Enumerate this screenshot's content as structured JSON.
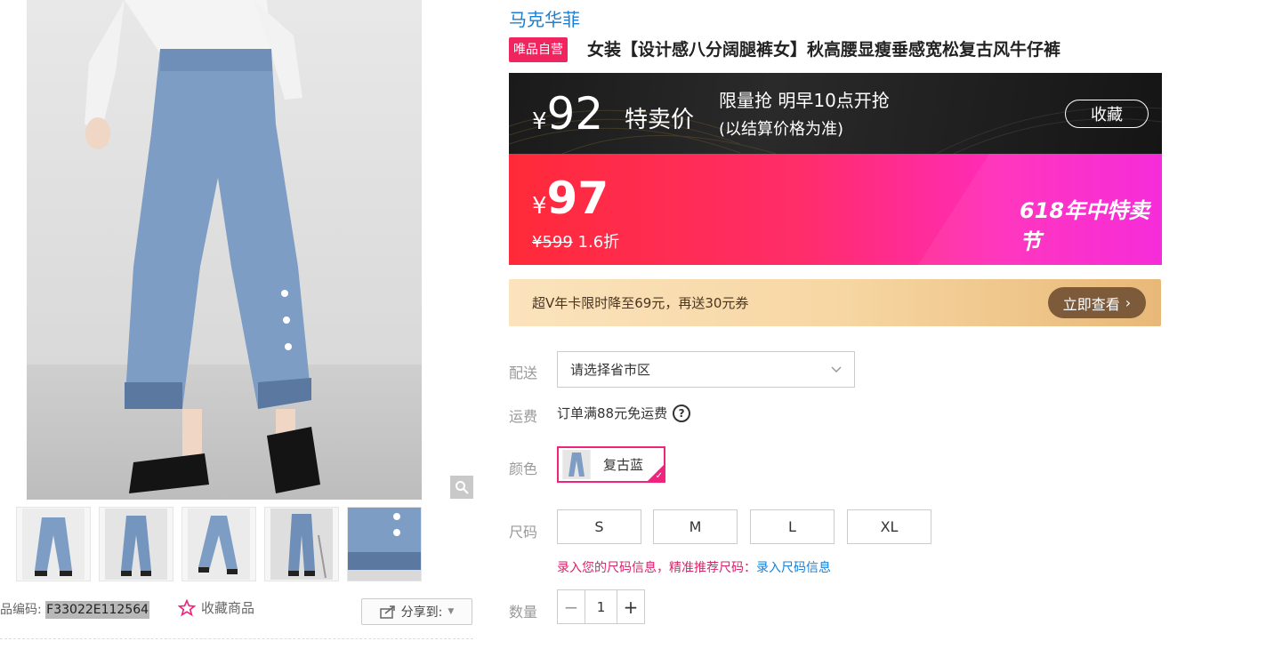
{
  "gallery": {
    "zoom_icon": "magnifier-icon",
    "thumbnails": [
      "jeans-front",
      "jeans-side",
      "jeans-model-walk",
      "jeans-chair",
      "jeans-hem-detail"
    ],
    "item_code_label": "品编码:",
    "item_code": "F33022E112564",
    "favorite_label": "收藏商品",
    "share_label": "分享到:"
  },
  "product": {
    "brand": "马克华菲",
    "tag": "唯品自营",
    "title": "女装【设计感八分阔腿裤女】秋高腰显瘦垂感宽松复古风牛仔裤"
  },
  "special_price": {
    "currency": "¥",
    "price": "92",
    "label": "特卖价",
    "limited": "限量抢 明早10点开抢",
    "note": "(以结算价格为准)",
    "collect_label": "收藏"
  },
  "current_price": {
    "currency": "¥",
    "price": "97",
    "original": "¥599",
    "discount": "1.6折",
    "event": "618年中特卖节"
  },
  "vip": {
    "text": "超V年卡限时降至69元，再送30元券",
    "button": "立即查看"
  },
  "options": {
    "delivery_label": "配送",
    "delivery_placeholder": "请选择省市区",
    "freight_label": "运费",
    "freight_text": "订单满88元免运费",
    "color_label": "颜色",
    "color_selected": "复古蓝",
    "size_label": "尺码",
    "sizes": [
      "S",
      "M",
      "L",
      "XL"
    ],
    "size_hint": "录入您的尺码信息，精准推荐尺码：",
    "size_hint_link": "录入尺码信息",
    "qty_label": "数量",
    "qty_value": "1",
    "qty_minus": "−",
    "qty_plus": "+"
  },
  "colors": {
    "accent_pink": "#f0245e",
    "brand_blue": "#1a7fd6",
    "vip_brown": "#7d5a3a"
  }
}
